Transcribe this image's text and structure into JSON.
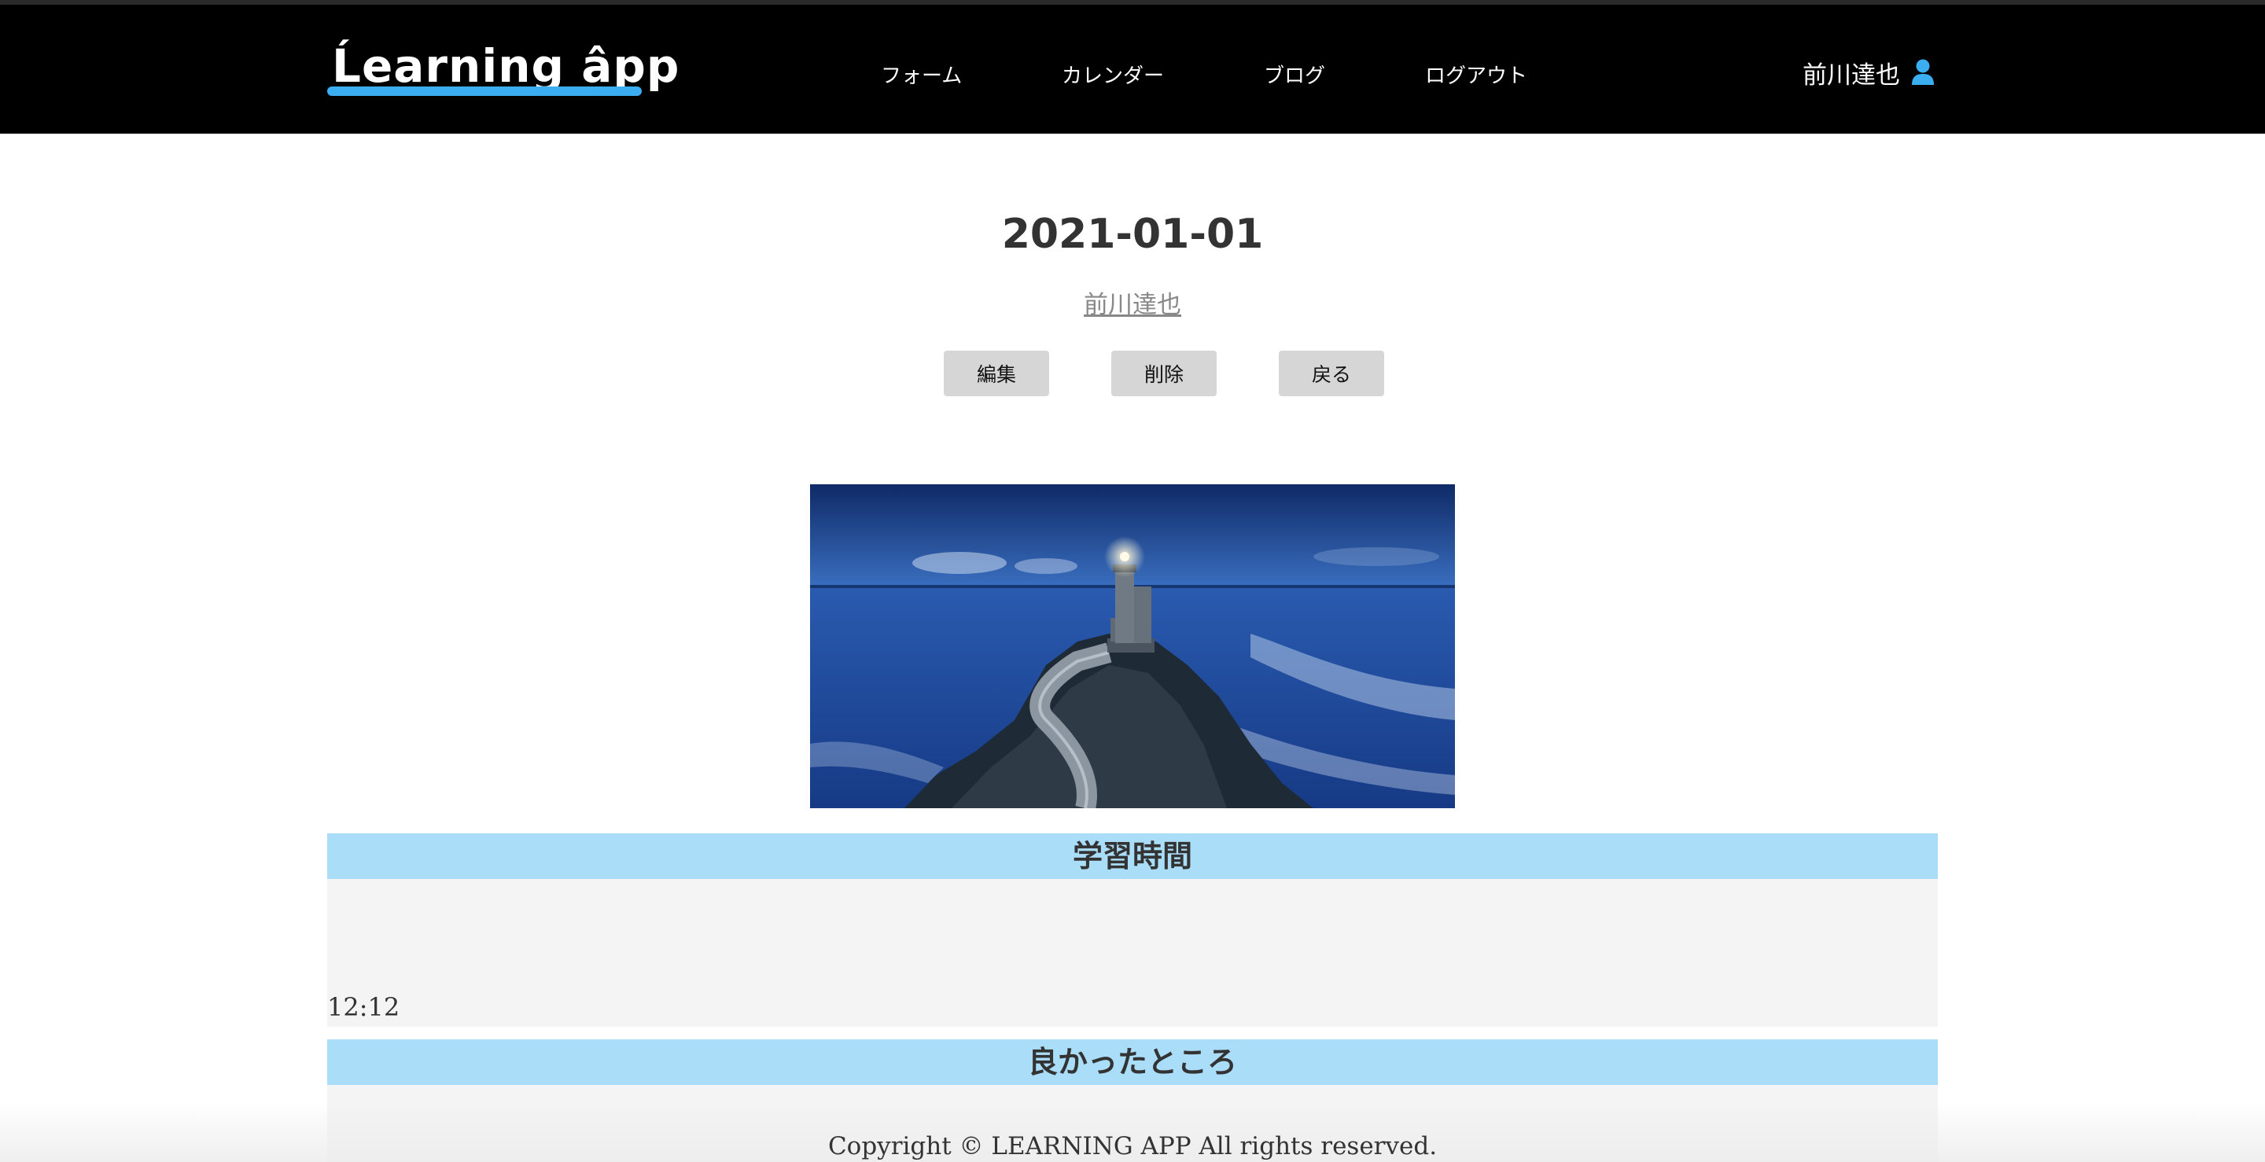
{
  "header": {
    "logo_text": "Ĺearning âpp",
    "nav": [
      {
        "label": "フォーム"
      },
      {
        "label": "カレンダー"
      },
      {
        "label": "ブログ"
      },
      {
        "label": "ログアウト"
      }
    ],
    "user_name": "前川達也",
    "user_icon": "user-icon",
    "accent_color": "#3aaef0"
  },
  "post": {
    "date": "2021-01-01",
    "author": "前川達也",
    "actions": {
      "edit_label": "編集",
      "delete_label": "削除",
      "back_label": "戻る"
    },
    "image_icon": "lighthouse-photo"
  },
  "sections": [
    {
      "title": "学習時間",
      "value": "12:12"
    },
    {
      "title": "良かったところ",
      "value": ""
    }
  ],
  "footer": {
    "copyright": "Copyright © LEARNING APP All rights reserved."
  },
  "colors": {
    "header_bg": "#000000",
    "section_bar_bg": "#a9ddf8",
    "section_body_bg": "#f4f4f4",
    "button_bg": "#d6d6d6"
  }
}
